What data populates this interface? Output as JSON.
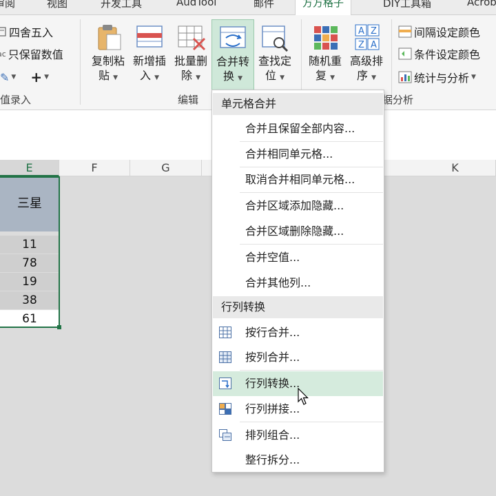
{
  "tabs": [
    "审阅",
    "视图",
    "开发工具",
    "AudTool",
    "邮件",
    "方方格子",
    "DIY工具箱",
    "Acrobat"
  ],
  "active_tab_index": 5,
  "ribbon": {
    "left_cmds": [
      "四舍五入",
      "只保留数值"
    ],
    "left_group_label": "值录入",
    "buttons": [
      {
        "line1": "复制粘",
        "line2": "贴"
      },
      {
        "line1": "新增插",
        "line2": "入"
      },
      {
        "line1": "批量删",
        "line2": "除"
      },
      {
        "line1": "合并转",
        "line2": "换"
      },
      {
        "line1": "查找定",
        "line2": "位"
      },
      {
        "line1": "随机重",
        "line2": "复"
      },
      {
        "line1": "高级排",
        "line2": "序"
      }
    ],
    "edit_group_label": "编辑",
    "right_cmds": [
      "间隔设定颜色",
      "条件设定颜色",
      "统计与分析"
    ],
    "analysis_group_label": "数据分析"
  },
  "columns": [
    "E",
    "F",
    "G",
    "K"
  ],
  "sheet": {
    "header": "三星",
    "values": [
      "11",
      "78",
      "19",
      "38",
      "61"
    ]
  },
  "menu": {
    "section1": "单元格合并",
    "items1": [
      "合并且保留全部内容...",
      "合并相同单元格...",
      "取消合并相同单元格...",
      "合并区域添加隐藏...",
      "合并区域删除隐藏...",
      "合并空值...",
      "合并其他列..."
    ],
    "section2": "行列转换",
    "items2": [
      "按行合并...",
      "按列合并...",
      "行列转换...",
      "行列拼接...",
      "排列组合...",
      "整行拆分..."
    ]
  },
  "colors": {
    "accent": "#217346",
    "hover": "#d5ebdd",
    "header_fill": "#aab5c3"
  }
}
